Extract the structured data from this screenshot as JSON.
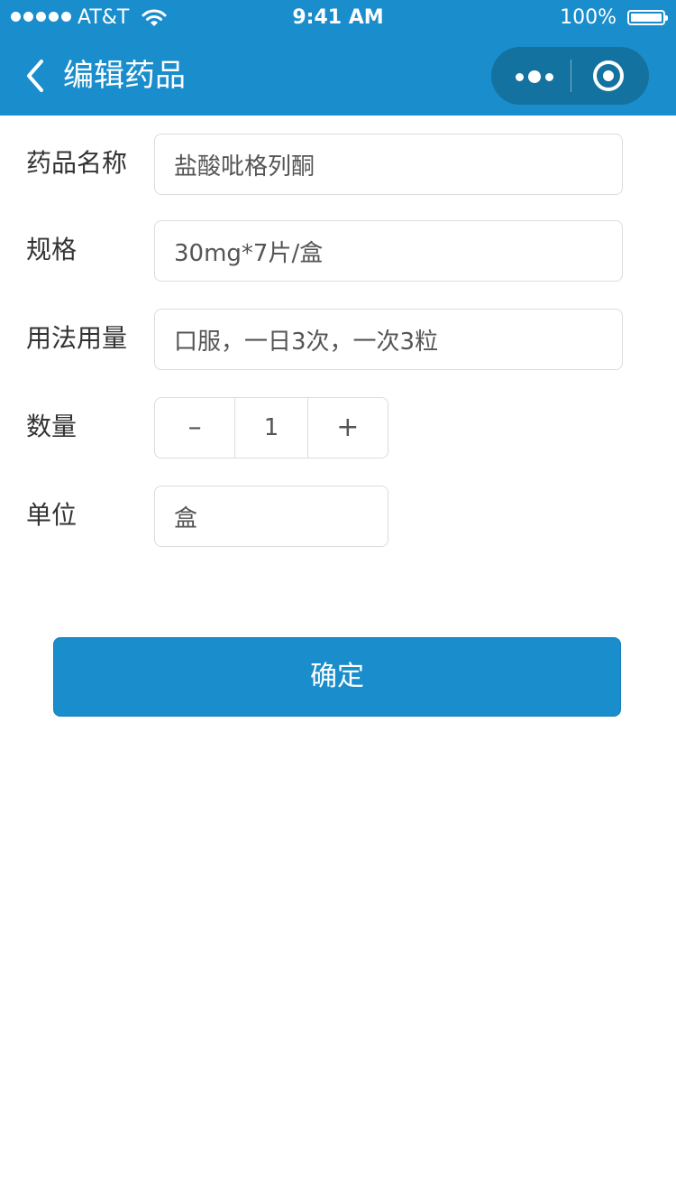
{
  "status_bar": {
    "carrier": "AT&T",
    "time": "9:41 AM",
    "battery": "100%",
    "battery_level": 1.0
  },
  "nav": {
    "title": "编辑药品",
    "back_icon": "chevron-left-icon",
    "more_icon": "more-dots-icon",
    "close_icon": "target-circle-icon"
  },
  "form": {
    "name_label": "药品名称",
    "name_value": "盐酸吡格列酮",
    "spec_label": "规格",
    "spec_value": "30mg*7片/盒",
    "usage_label": "用法用量",
    "usage_value": "口服，一日3次，一次3粒",
    "quantity_label": "数量",
    "quantity_minus": "–",
    "quantity_value": "1",
    "quantity_plus": "+",
    "unit_label": "单位",
    "unit_value": "盒"
  },
  "confirm_label": "确定",
  "colors": {
    "brand": "#1a8dcc",
    "capsule": "#13729f",
    "border": "#dcdcdc"
  }
}
